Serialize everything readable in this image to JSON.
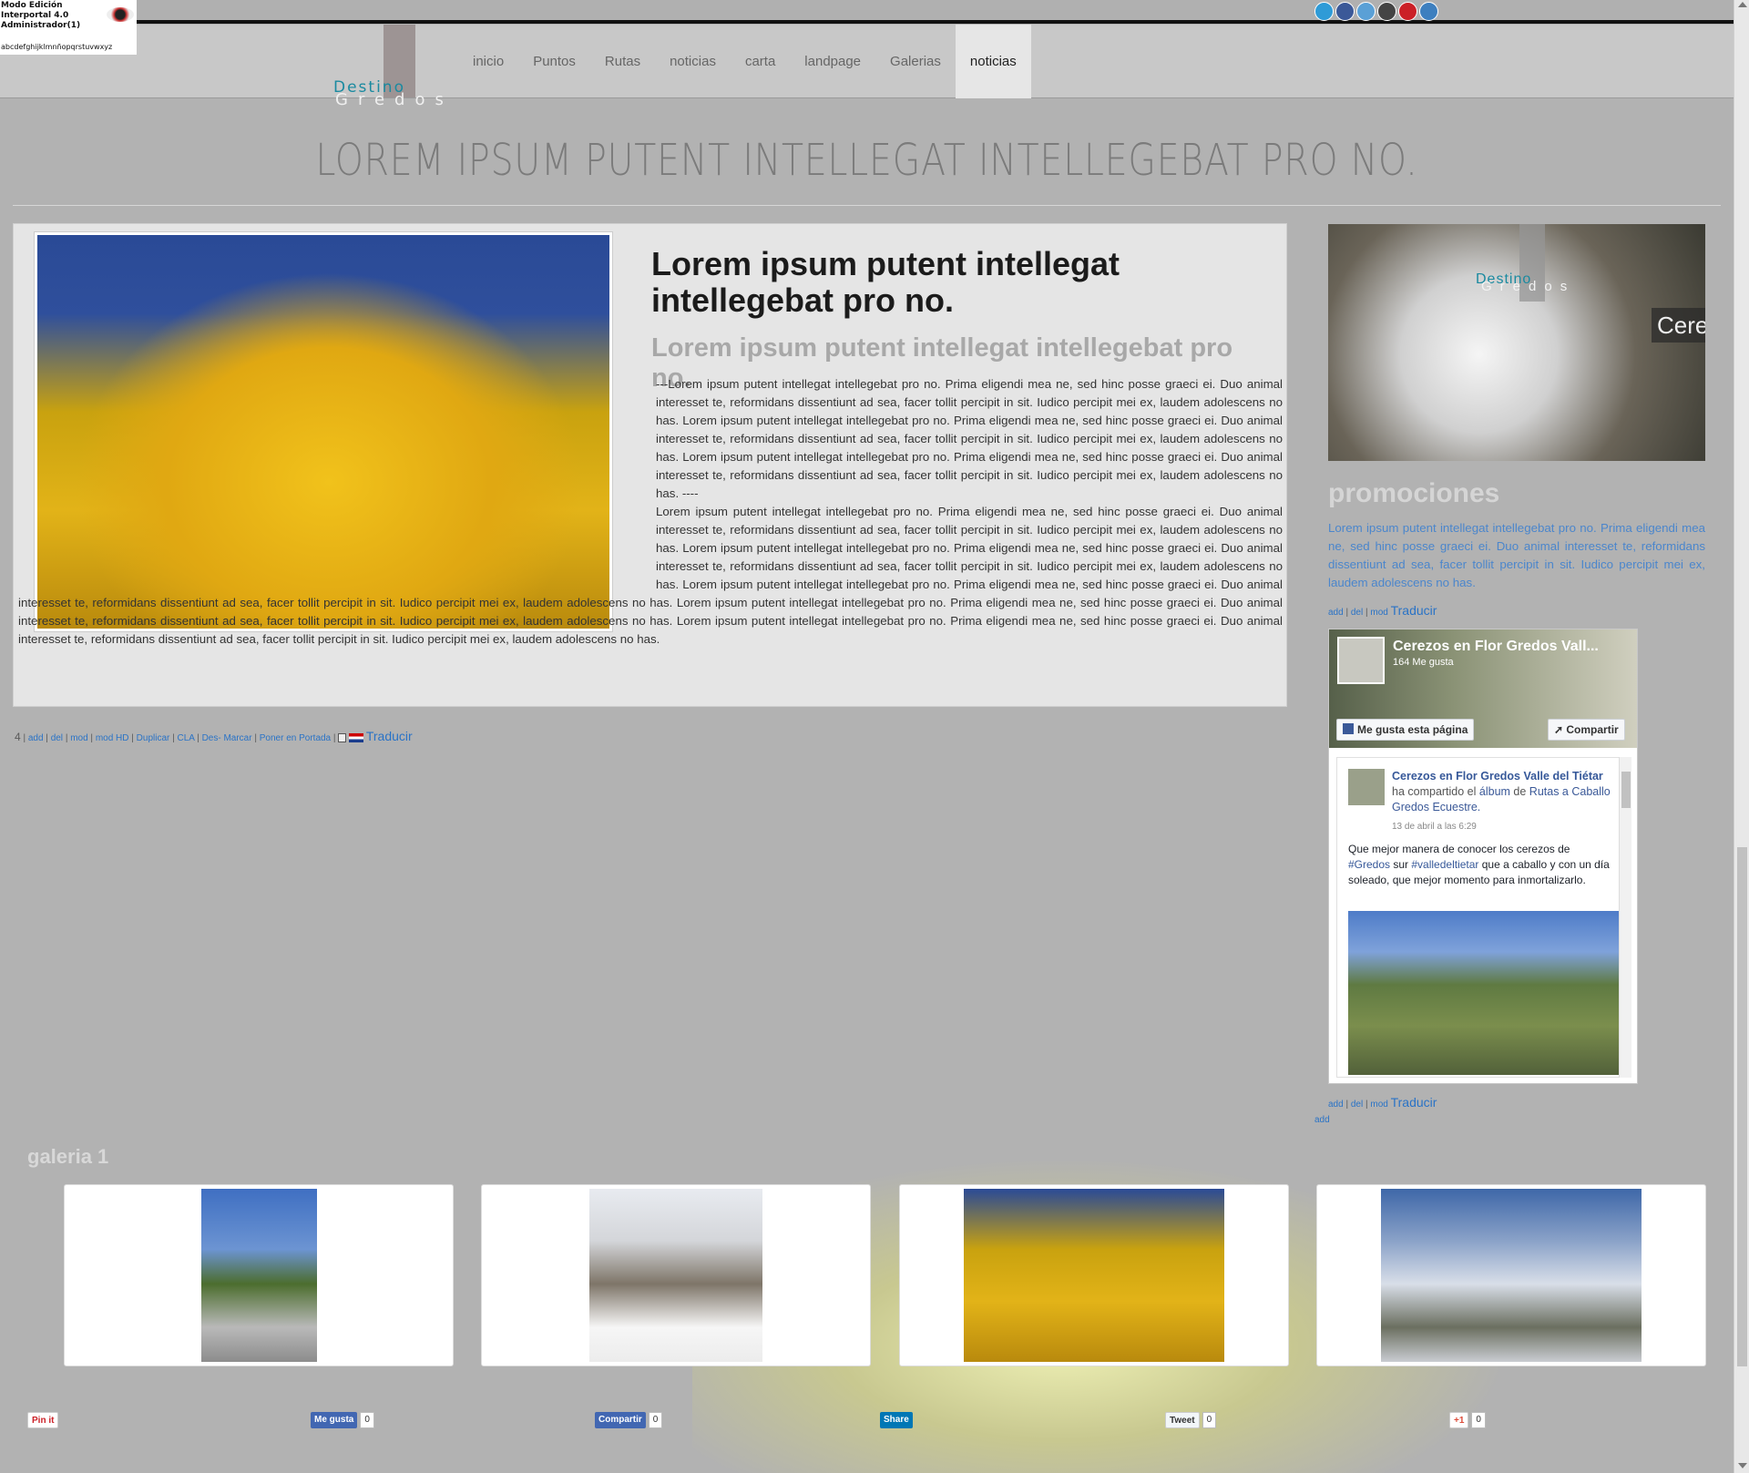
{
  "admin": {
    "line1": "Modo Edición",
    "line2": "Interportal 4.0",
    "line3": "Administrador(1)",
    "alphabet": "abcdefghijklmnñopqrstuvwxyz"
  },
  "social_top_icons": [
    "twitter-icon",
    "facebook-icon",
    "linkedin-icon",
    "delicious-icon",
    "pinterest-icon",
    "share-icon"
  ],
  "nav": {
    "items": [
      "inicio",
      "Puntos",
      "Rutas",
      "noticias",
      "carta",
      "landpage",
      "Galerias",
      "noticias"
    ],
    "active_index": 7
  },
  "logo": {
    "word1": "Destino",
    "word2": "Gredos"
  },
  "page_title": "LOREM IPSUM PUTENT INTELLEGAT INTELLEGEBAT PRO NO.",
  "article": {
    "heading": "Lorem ipsum putent intellegat intellegebat pro no.",
    "subheading": "Lorem ipsum putent intellegat intellegebat pro no.",
    "para1": "---Lorem ipsum putent intellegat intellegebat pro no. Prima eligendi mea ne, sed hinc posse graeci ei. Duo animal interesset te, reformidans dissentiunt ad sea, facer tollit percipit in sit. Iudico percipit mei ex, laudem adolescens no has. Lorem ipsum putent intellegat intellegebat pro no. Prima eligendi mea ne, sed hinc posse graeci ei. Duo animal interesset te, reformidans dissentiunt ad sea, facer tollit percipit in sit. Iudico percipit mei ex, laudem adolescens no has. Lorem ipsum putent intellegat intellegebat pro no. Prima eligendi mea ne, sed hinc posse graeci ei. Duo animal interesset te, reformidans dissentiunt ad sea, facer tollit percipit in sit. Iudico percipit mei ex, laudem adolescens no has. ----",
    "para2": "Lorem ipsum putent intellegat intellegebat pro no. Prima eligendi mea ne, sed hinc posse graeci ei. Duo animal interesset te, reformidans dissentiunt ad sea, facer tollit percipit in sit. Iudico percipit mei ex, laudem adolescens no has. Lorem ipsum putent intellegat intellegebat pro no. Prima eligendi mea ne, sed hinc posse graeci ei. Duo animal interesset te, reformidans dissentiunt ad sea, facer tollit percipit in sit. Iudico percipit mei ex, laudem adolescens no has. Lorem ipsum putent intellegat intellegebat pro no. Prima eligendi mea ne, sed hinc posse graeci ei. Duo animal interesset te, reformidans dissentiunt ad sea, facer tollit percipit in sit. Iudico percipit mei ex, laudem adolescens no has. Lorem ipsum putent intellegat intellegebat pro no. Prima eligendi mea ne, sed hinc posse graeci ei. Duo animal interesset te, reformidans dissentiunt ad sea, facer tollit percipit in sit. Iudico percipit mei ex, laudem adolescens no has. Lorem ipsum putent intellegat intellegebat pro no. Prima eligendi mea ne, sed hinc posse graeci ei. Duo animal interesset te, reformidans dissentiunt ad sea, facer tollit percipit in sit. Iudico percipit mei ex, laudem adolescens no has."
  },
  "article_admin": {
    "count": "4",
    "links": [
      "add",
      "del",
      "mod",
      "mod HD",
      "Duplicar",
      "CLA",
      "Des- Marcar",
      "Poner en Portada"
    ],
    "translate": "Traducir"
  },
  "sidebar": {
    "banner_dest": "Destino",
    "banner_gredos": "Gredos",
    "banner_text": "Cere",
    "promo_heading": "promociones",
    "promo_text": "Lorem ipsum putent intellegat intellegebat pro no. Prima eligendi mea ne, sed hinc posse graeci ei. Duo animal interesset te, reformidans dissentiunt ad sea, facer tollit percipit in sit. Iudico percipit mei ex, laudem adolescens no has.",
    "admin_links": [
      "add",
      "del",
      "mod"
    ],
    "translate": "Traducir",
    "add_only": "add"
  },
  "facebook": {
    "page_title": "Cerezos en Flor Gredos Vall...",
    "likes": "164 Me gusta",
    "like_btn": "Me gusta esta página",
    "share_btn": "Compartir",
    "post_author": "Cerezos en Flor Gredos Valle del Tiétar",
    "post_action": " ha compartido el ",
    "post_album_word": "álbum",
    "post_of": " de ",
    "post_target": "Rutas a Caballo Gredos Ecuestre.",
    "post_date": "13 de abril a las 6:29",
    "post_text_1": "Que mejor manera de conocer los cerezos de ",
    "post_tag1": "#Gredos",
    "post_text_2": " sur ",
    "post_tag2": "#valledeltietar",
    "post_text_3": " que a caballo y con un día soleado, que mejor momento para inmortalizarlo."
  },
  "gallery": {
    "heading": "galeria 1",
    "items": [
      {
        "name": "pine-tree-photo",
        "colors": [
          "#3f6fc2",
          "#5c8a3a",
          "#a8a8a8"
        ]
      },
      {
        "name": "snowy-street-photo",
        "colors": [
          "#dfe3ea",
          "#8b8072",
          "#f4f4f4"
        ]
      },
      {
        "name": "autumn-tree-photo",
        "colors": [
          "#2a4a96",
          "#e0a812",
          "#b98a0d"
        ]
      },
      {
        "name": "frosted-park-photo",
        "colors": [
          "#4a6fae",
          "#d6dce6",
          "#6b6f60"
        ]
      }
    ]
  },
  "share": {
    "pinit": "Pin it",
    "like": "Me gusta",
    "like_count": "0",
    "share": "Compartir",
    "share_count": "0",
    "linkedin": "Share",
    "tweet": "Tweet",
    "tweet_count": "0",
    "gplus": "+1",
    "gplus_count": "0"
  }
}
